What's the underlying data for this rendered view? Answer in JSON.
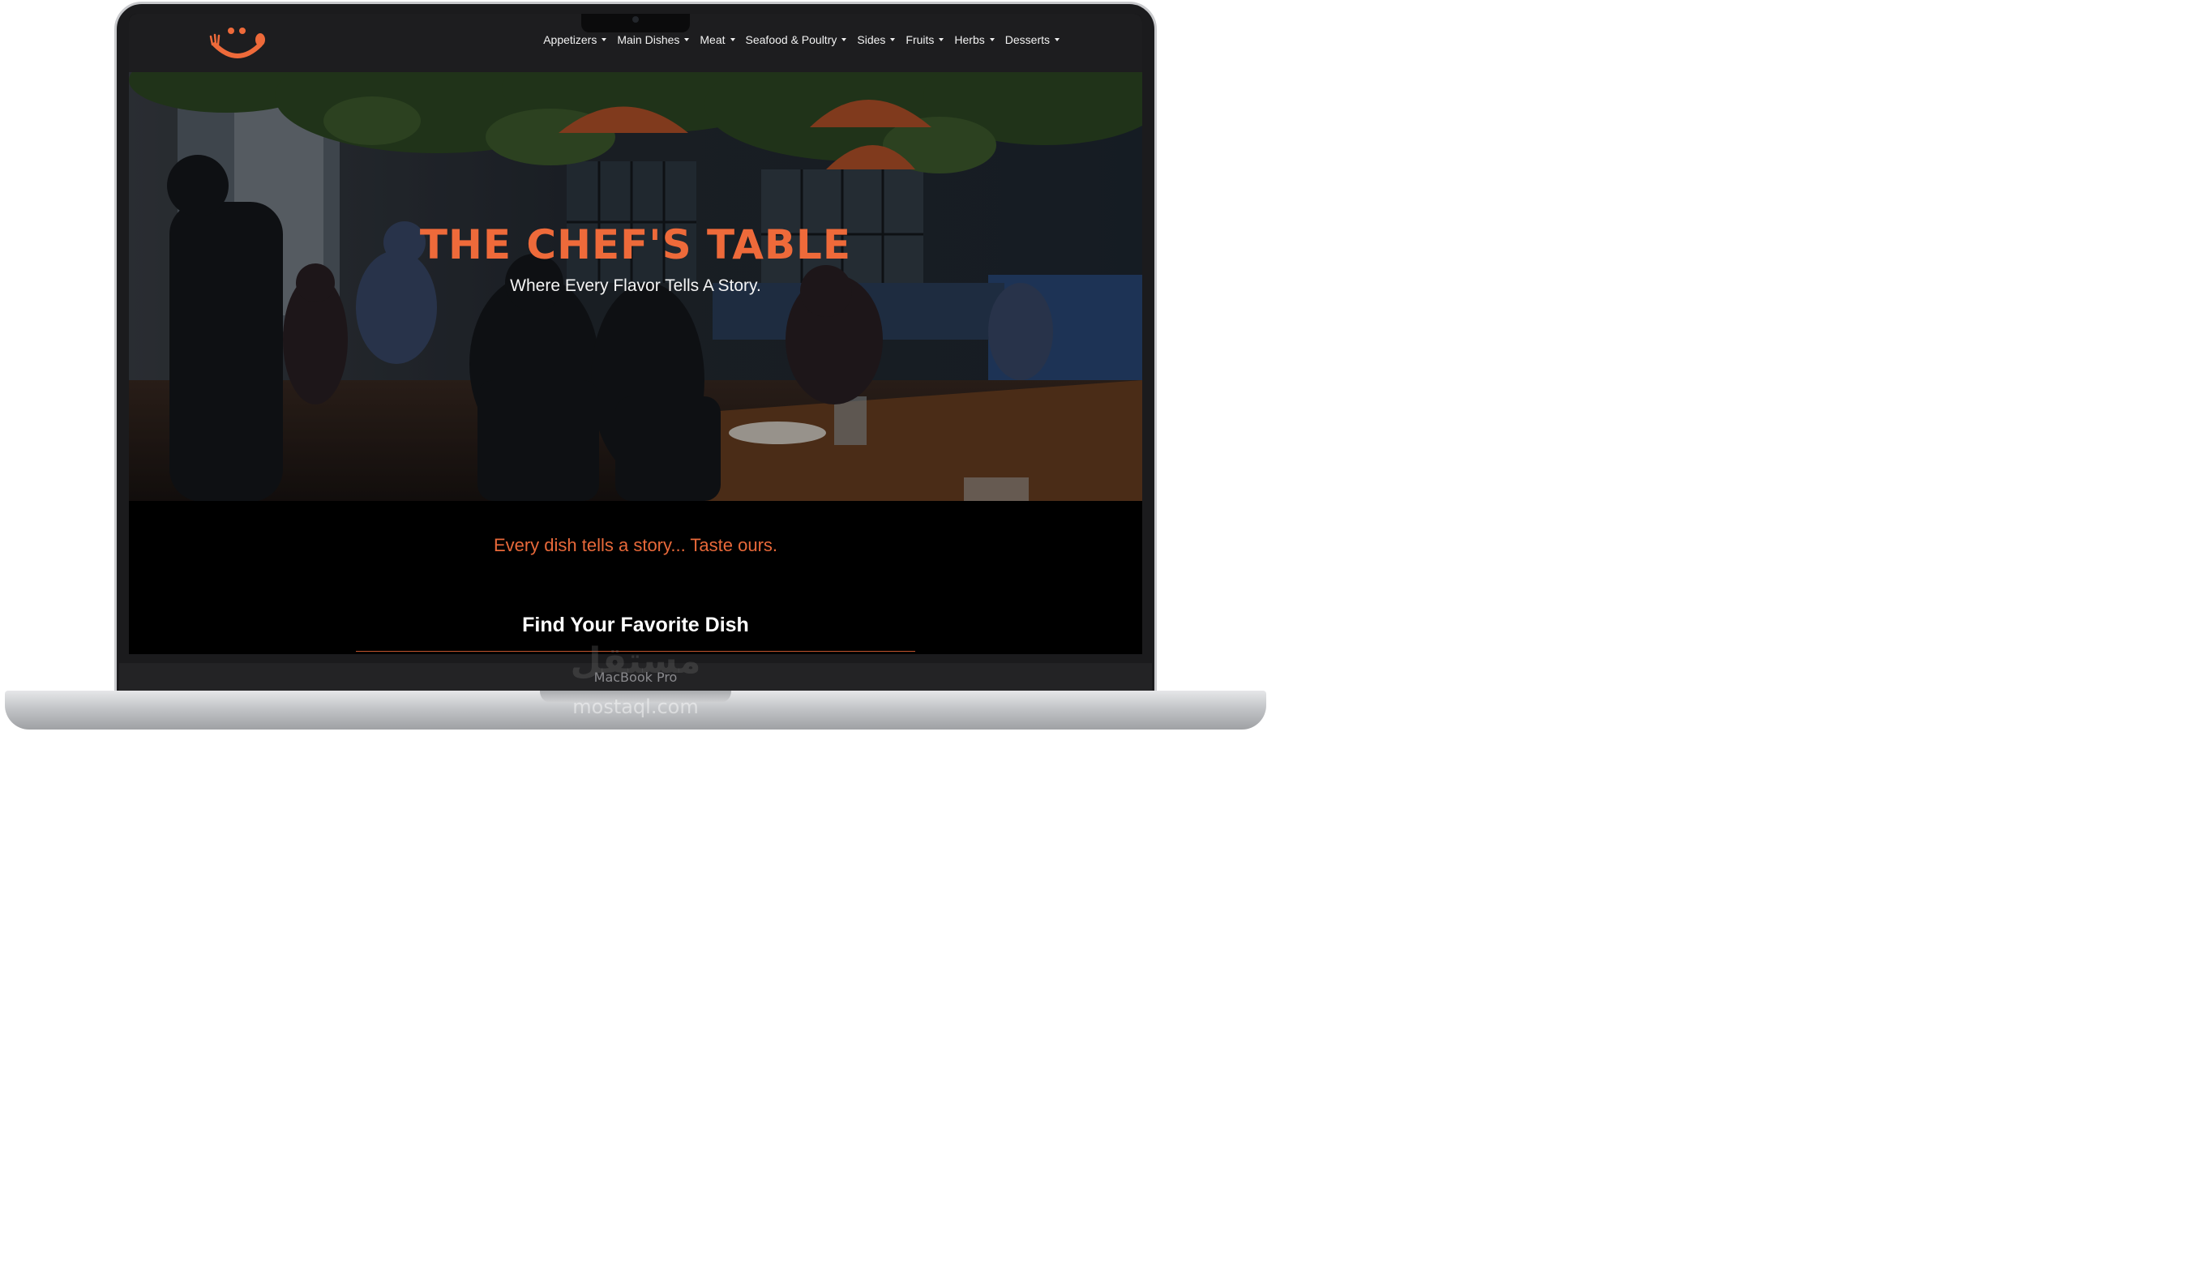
{
  "device": {
    "model_label": "MacBook Pro"
  },
  "watermark": {
    "text": "مستقل",
    "sub": "mostaql.com"
  },
  "navbar": {
    "logo_icon": "smiley-fork-spoon-icon",
    "brand_color": "#ee6a3a",
    "items": [
      {
        "label": "Appetizers"
      },
      {
        "label": "Main Dishes"
      },
      {
        "label": "Meat"
      },
      {
        "label": "Seafood & Poultry"
      },
      {
        "label": "Sides"
      },
      {
        "label": "Fruits"
      },
      {
        "label": "Herbs"
      },
      {
        "label": "Desserts"
      }
    ]
  },
  "hero": {
    "title": "THE CHEF'S TABLE",
    "subtitle": "Where Every Flavor Tells A Story."
  },
  "intro": {
    "tagline": "Every dish tells a story... Taste ours.",
    "section_title": "Find Your Favorite Dish"
  }
}
